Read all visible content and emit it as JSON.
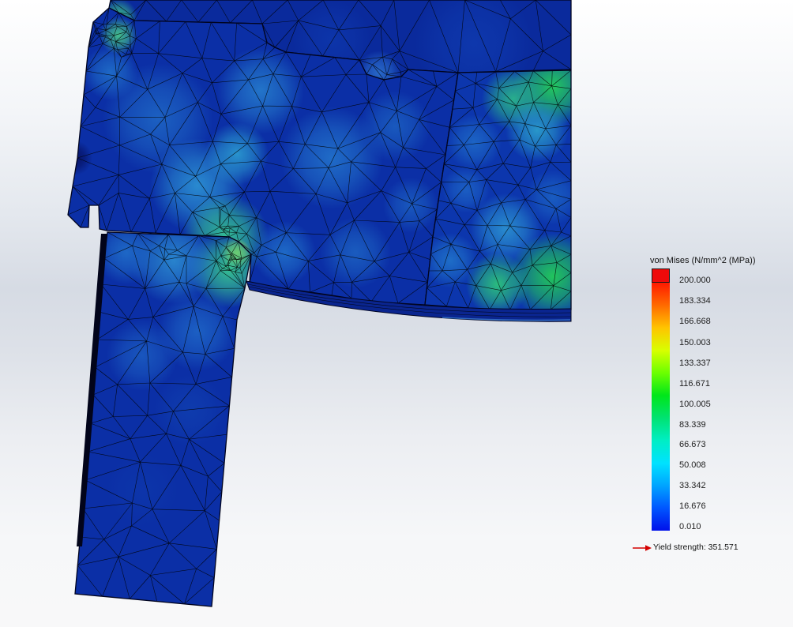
{
  "legend": {
    "title": "von Mises (N/mm^2 (MPa))",
    "ticks": [
      "200.000",
      "183.334",
      "166.668",
      "150.003",
      "133.337",
      "116.671",
      "100.005",
      "83.339",
      "66.673",
      "50.008",
      "33.342",
      "16.676",
      "0.010"
    ],
    "yield_label": "Yield strength: 351.571",
    "max_color": "#ee0a0a",
    "colormap": [
      "#ff1a00",
      "#ff6a00",
      "#ffc400",
      "#d8ff00",
      "#6cff00",
      "#00e61a",
      "#00e272",
      "#00eec4",
      "#00e2ff",
      "#00a4ff",
      "#0056ff",
      "#0010ea"
    ],
    "arrow_color": "#d40000"
  },
  "model": {
    "base_color": "#0b2fa6",
    "mesh_color": "#000000"
  },
  "icons": {
    "yield_arrow": "arrow-right-icon"
  }
}
